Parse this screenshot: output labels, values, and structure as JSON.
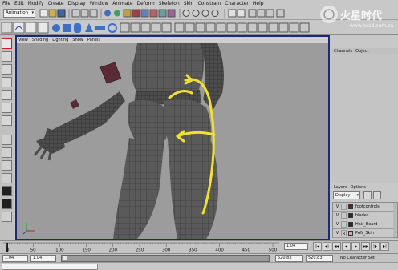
{
  "menubar": {
    "items": [
      "File",
      "Edit",
      "Modify",
      "Create",
      "Display",
      "Window",
      "Animate",
      "Deform",
      "Skeleton",
      "Skin",
      "Constrain",
      "Character",
      "Help"
    ]
  },
  "status_line": {
    "mode_label": "Animation"
  },
  "viewport": {
    "panel_menu": [
      "View",
      "Shading",
      "Lighting",
      "Show",
      "Panels"
    ]
  },
  "channel_box": {
    "tabs": [
      "Channels",
      "Object"
    ]
  },
  "layers": {
    "menu": [
      "Layers",
      "Options"
    ],
    "type_label": "Display",
    "rows": [
      {
        "visible": "V",
        "template": "",
        "color": "#8a1020",
        "name": "footcontrols"
      },
      {
        "visible": "V",
        "template": "",
        "color": "#2a2a2a",
        "name": "blades"
      },
      {
        "visible": "V",
        "template": "",
        "color": "#2a2a2a",
        "name": "Hair_Beard"
      },
      {
        "visible": "V",
        "template": "R",
        "color": "#e0a0b0",
        "name": "PAN_Skin"
      }
    ]
  },
  "timeline": {
    "ticks": [
      "0",
      "50",
      "100",
      "150",
      "200",
      "250",
      "300",
      "350",
      "400",
      "450",
      "500"
    ],
    "current_frame": "1.04"
  },
  "range": {
    "start": "1.04",
    "playback_start": "1.04",
    "playback_end": "520.83",
    "end": "520.83",
    "character_set": "No Character Set"
  },
  "watermark": {
    "text": "火星时代",
    "url": "www.hxsd.com.cn"
  },
  "colors": {
    "viewport_border": "#1a2a7a",
    "stroke_yellow": "#f2e22a",
    "mesh_dark": "#555555"
  }
}
